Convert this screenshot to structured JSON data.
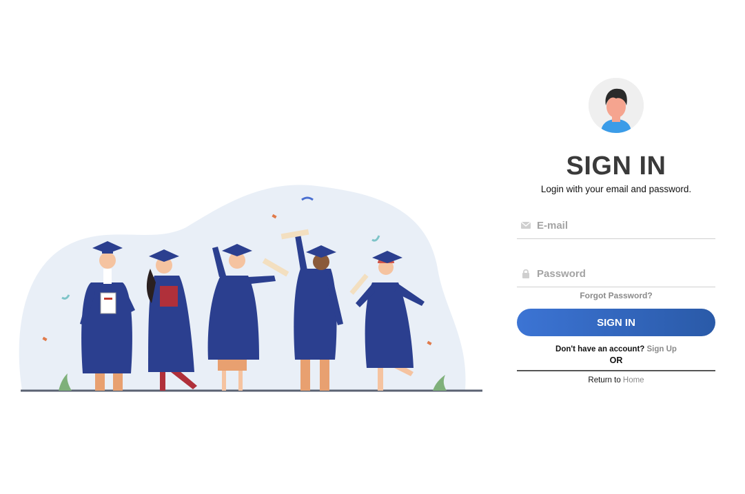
{
  "login": {
    "title": "SIGN IN",
    "subtitle": "Login with your email and password.",
    "email_placeholder": "E-mail",
    "password_placeholder": "Password",
    "forgot_password": "Forgot Password?",
    "signin_button": "SIGN IN",
    "no_account_text": "Don't have an account? ",
    "signup_link": "Sign Up",
    "or_text": "OR",
    "return_text": "Return to ",
    "home_link": "Home"
  },
  "icons": {
    "avatar": "user-avatar-icon",
    "email": "envelope-icon",
    "password": "lock-icon"
  },
  "colors": {
    "primary_button_start": "#3c74d4",
    "primary_button_end": "#2a5aa8",
    "title": "#3a3a3a",
    "link_muted": "#8a8a8a",
    "gown": "#2b3f8f"
  }
}
